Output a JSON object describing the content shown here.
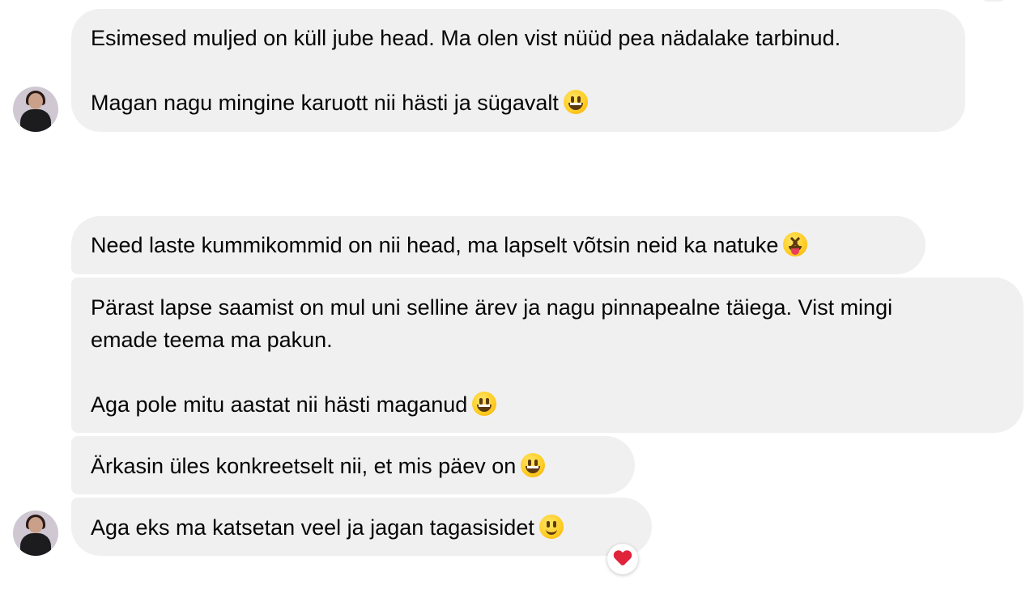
{
  "messages": [
    {
      "lines": [
        "Esimesed muljed on küll jube head. Ma olen vist nüüd pea nädalake tarbinud.",
        "",
        "Magan nagu mingine karuott nii hästi ja sügavalt"
      ],
      "emoji": "grinning-face"
    },
    {
      "lines": [
        "Need laste kummikommid on nii head, ma lapselt võtsin neid ka natuke"
      ],
      "emoji": "squinting-face-with-tongue"
    },
    {
      "lines": [
        "Pärast lapse saamist on mul uni selline ärev ja nagu pinnapealne täiega. Vist mingi",
        "emade teema ma pakun.",
        "",
        "Aga pole mitu aastat nii hästi maganud"
      ],
      "emoji": "grinning-face"
    },
    {
      "lines": [
        "Ärkasin üles konkreetselt nii, et mis päev on"
      ],
      "emoji": "grinning-face"
    },
    {
      "lines": [
        "Aga eks ma katsetan veel ja jagan tagasisidet"
      ],
      "emoji": "slightly-smiling-face",
      "reaction": "red-heart"
    }
  ],
  "colors": {
    "bubble_bg": "#f0f0f0",
    "text": "#050505",
    "heart": "#e0243a"
  }
}
